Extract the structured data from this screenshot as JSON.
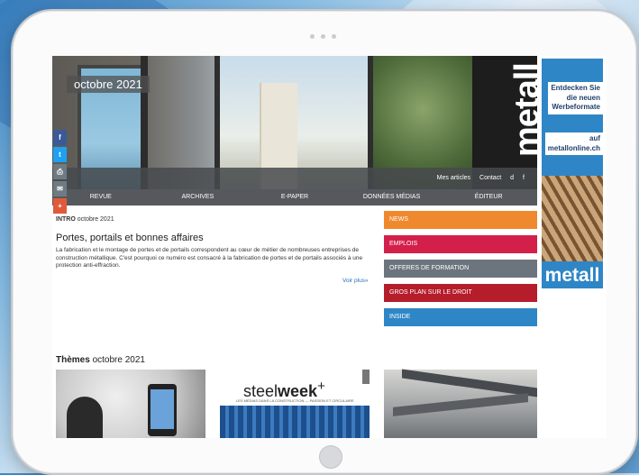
{
  "hero": {
    "date_tag": "octobre 2021",
    "logo": "metall",
    "sub_links": [
      "Mes articles",
      "Contact",
      "d",
      "f"
    ]
  },
  "nav": [
    "REVUE",
    "ARCHIVES",
    "E-PAPER",
    "DONNÉES MÉDIAS",
    "ÉDITEUR"
  ],
  "share": [
    {
      "icon": "facebook-icon",
      "glyph": "f",
      "color": "#3b5998"
    },
    {
      "icon": "twitter-icon",
      "glyph": "t",
      "color": "#1da1f2"
    },
    {
      "icon": "print-icon",
      "glyph": "⎙",
      "color": "#6f7a82"
    },
    {
      "icon": "mail-icon",
      "glyph": "✉",
      "color": "#6f7a82"
    },
    {
      "icon": "plus-icon",
      "glyph": "+",
      "color": "#e05a3a"
    }
  ],
  "ad": {
    "line1": "Entdecken Sie",
    "line2": "die neuen",
    "line3": "Werbeformate",
    "line4": "auf",
    "line5": "metallonline.ch",
    "brand": "metall"
  },
  "article": {
    "intro_label": "INTRO",
    "intro_date": "octobre 2021",
    "title": "Portes, portails et bonnes affaires",
    "body": "La fabrication et le montage de portes et de portails correspondent au cœur de métier de nombreuses entreprises de construction métallique. C'est pourquoi ce numéro est consacré à la fabrication de portes et de portails associés à une protection anti-effraction.",
    "more": "Voir plus»"
  },
  "right_menu": [
    {
      "label": "NEWS",
      "color": "#f0882e"
    },
    {
      "label": "EMPLOIS",
      "color": "#d41f4a"
    },
    {
      "label": "OFFERES DE FORMATION",
      "color": "#6c757d"
    },
    {
      "label": "GROS PLAN SUR LE DROIT",
      "color": "#b51d2a"
    },
    {
      "label": "INSIDE",
      "color": "#2f86c6"
    }
  ],
  "themes": {
    "heading_bold": "Thèmes",
    "heading_date": "octobre 2021",
    "steelweek_a": "steel",
    "steelweek_b": "week",
    "steelweek_plus": "+",
    "steelweek_sub": "LES MÉDIAS DANS LA CONSTRUCTION — PASSION ET CIRCULAIRE"
  }
}
